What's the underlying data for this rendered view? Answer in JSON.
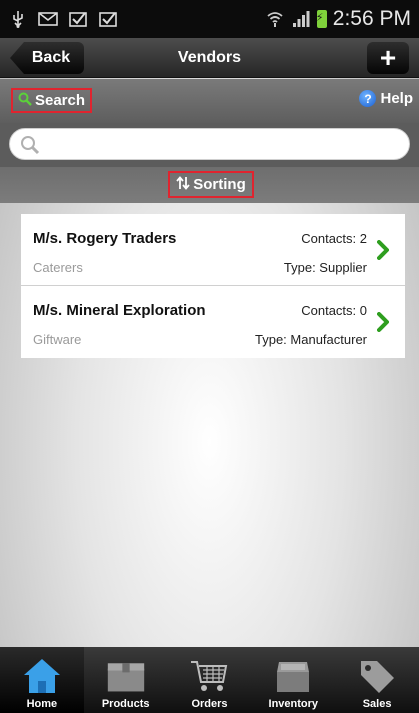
{
  "status_bar": {
    "time": "2:56 PM",
    "icons": [
      "usb-icon",
      "mail-icon",
      "check-icon",
      "check-icon",
      "wifi-icon",
      "signal-icon",
      "battery-icon"
    ]
  },
  "header": {
    "title": "Vendors",
    "back_label": "Back",
    "add_icon": "plus-icon"
  },
  "toolbar": {
    "search_label": "Search",
    "help_label": "Help",
    "sorting_label": "Sorting"
  },
  "search": {
    "value": "",
    "placeholder": ""
  },
  "vendors": [
    {
      "name": "M/s. Rogery Traders",
      "category": "Caterers",
      "contacts": "Contacts: 2",
      "type": "Type: Supplier"
    },
    {
      "name": "M/s. Mineral Exploration",
      "category": "Giftware",
      "contacts": "Contacts: 0",
      "type": "Type: Manufacturer"
    }
  ],
  "tabs": [
    {
      "label": "Home",
      "icon": "home-icon",
      "active": true
    },
    {
      "label": "Products",
      "icon": "box-icon"
    },
    {
      "label": "Orders",
      "icon": "cart-icon"
    },
    {
      "label": "Inventory",
      "icon": "inventory-icon"
    },
    {
      "label": "Sales",
      "icon": "tag-icon"
    }
  ],
  "colors": {
    "highlight_border": "#e0242f",
    "chevron": "#2e9e1f",
    "home_icon": "#3aa0e8"
  }
}
